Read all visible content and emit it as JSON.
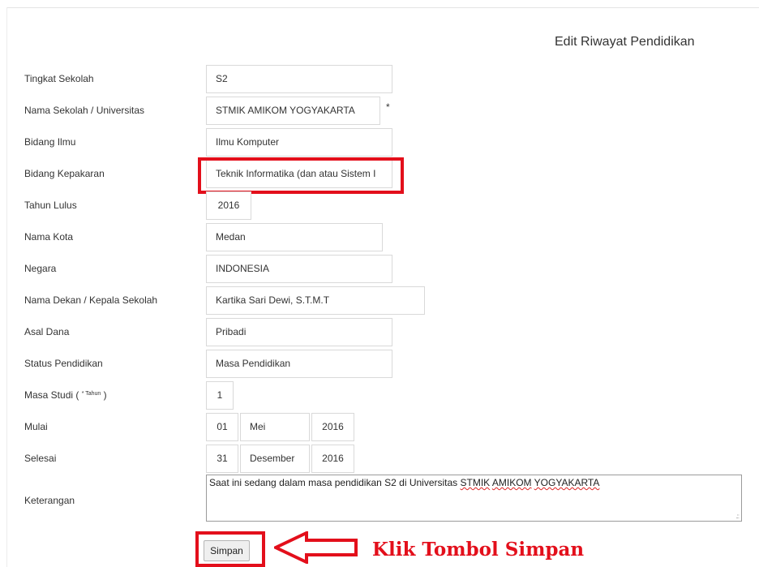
{
  "page_title": "Edit Riwayat Pendidikan",
  "form": {
    "tingkat_sekolah": {
      "label": "Tingkat Sekolah",
      "value": "S2"
    },
    "nama_sekolah": {
      "label": "Nama Sekolah / Universitas",
      "value": "STMIK AMIKOM YOGYAKARTA",
      "required_mark": "*"
    },
    "bidang_ilmu": {
      "label": "Bidang Ilmu",
      "value": "Ilmu Komputer"
    },
    "bidang_kepakaran": {
      "label": "Bidang Kepakaran",
      "value": "Teknik Informatika (dan atau Sistem I"
    },
    "tahun_lulus": {
      "label": "Tahun Lulus",
      "value": "2016"
    },
    "nama_kota": {
      "label": "Nama Kota",
      "value": "Medan"
    },
    "negara": {
      "label": "Negara",
      "value": "INDONESIA"
    },
    "nama_dekan": {
      "label": "Nama Dekan / Kepala Sekolah",
      "value": "Kartika Sari Dewi, S.T.M.T"
    },
    "asal_dana": {
      "label": "Asal Dana",
      "value": "Pribadi"
    },
    "status_pendidikan": {
      "label": "Status Pendidikan",
      "value": "Masa Pendidikan"
    },
    "masa_studi": {
      "label": "Masa Studi (",
      "label_sup": "* Tahun",
      "label_end": ")",
      "value": "1"
    },
    "mulai": {
      "label": "Mulai",
      "day": "01",
      "month": "Mei",
      "year": "2016"
    },
    "selesai": {
      "label": "Selesai",
      "day": "31",
      "month": "Desember",
      "year": "2016"
    },
    "keterangan": {
      "label": "Keterangan",
      "value_prefix": "Saat ini sedang dalam masa pendidikan S2 di Universitas ",
      "value_w1": "STMIK",
      "value_w2": "AMIKOM",
      "value_w3": "YOGYAKARTA"
    }
  },
  "simpan_label": "Simpan",
  "annotation": {
    "callout_text": "Klik Tombol Simpan",
    "highlight_color": "#e30f1b"
  }
}
